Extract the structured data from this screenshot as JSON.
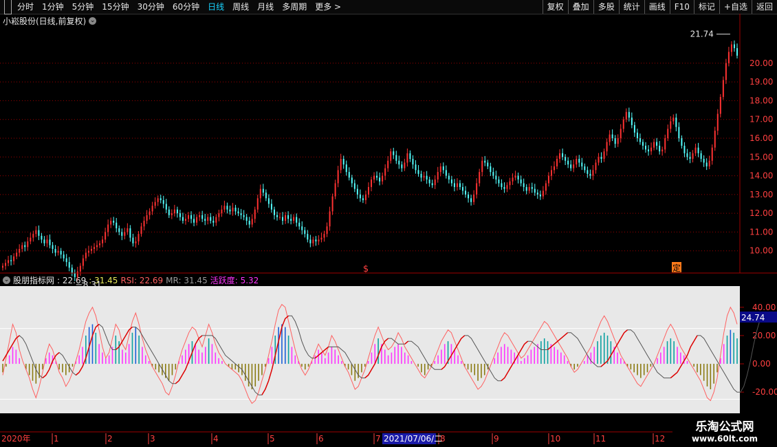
{
  "toolbar": {
    "tabs": [
      "分时",
      "1分钟",
      "5分钟",
      "15分钟",
      "30分钟",
      "60分钟",
      "日线",
      "周线",
      "月线",
      "多周期",
      "更多 >"
    ],
    "active_tab": "日线",
    "right": [
      "复权",
      "叠加",
      "多股",
      "统计",
      "画线",
      "F10",
      "标记",
      "+自选",
      "返回"
    ]
  },
  "price_panel": {
    "title": "小崧股份(日线,前复权)",
    "high_label": "21.74",
    "low_label": "8.31",
    "markers": [
      "$",
      "定"
    ]
  },
  "indicator_panel": {
    "name": "股朋指标网",
    "v1": ": 22.69",
    "v2": ": 31.45",
    "rsi": "RSI: 22.69",
    "mr": "MR: 31.45",
    "huoyue": "活跃度: 5.32",
    "current_value": "24.74"
  },
  "dates": {
    "year": "2020年",
    "months": [
      "1",
      "2",
      "3",
      "4",
      "5",
      "6",
      "7",
      "8",
      "9",
      "10",
      "11",
      "12"
    ],
    "cursor": "2021/07/06/二"
  },
  "colors": {
    "up": "#ff3232",
    "down": "#54ffff",
    "grid": "#a00000",
    "accent": "#19d4ff",
    "rsi": "#ff6060",
    "mr": "#555555",
    "huoyue": "#ff33ff"
  },
  "chart_data": [
    {
      "type": "candlestick",
      "title": "小崧股份(日线,前复权)",
      "ylim": [
        9.0,
        21.9
      ],
      "yticks": [
        10,
        11,
        12,
        13,
        14,
        15,
        16,
        17,
        18,
        19,
        20
      ],
      "ytick_labels": [
        "10.00",
        "11.00",
        "12.00",
        "13.00",
        "14.00",
        "15.00",
        "16.00",
        "17.00",
        "18.00",
        "19.00",
        "20.00"
      ],
      "close": [
        9.2,
        9.35,
        9.5,
        9.45,
        9.7,
        9.9,
        10.1,
        10.3,
        10.2,
        10.5,
        10.7,
        10.9,
        11.1,
        10.8,
        10.6,
        10.4,
        10.6,
        10.3,
        10.1,
        9.9,
        10.0,
        9.8,
        9.6,
        9.4,
        9.1,
        8.8,
        8.6,
        8.9,
        9.2,
        9.6,
        9.9,
        10.0,
        10.1,
        10.2,
        10.3,
        10.4,
        10.6,
        11.0,
        11.4,
        11.6,
        11.5,
        11.2,
        11.0,
        10.8,
        11.0,
        11.2,
        10.7,
        10.4,
        10.5,
        10.9,
        11.3,
        11.6,
        11.9,
        12.1,
        12.4,
        12.6,
        12.8,
        12.7,
        12.5,
        12.2,
        11.9,
        12.0,
        12.2,
        12.0,
        11.8,
        11.6,
        11.7,
        11.9,
        11.7,
        11.5,
        11.8,
        11.9,
        11.7,
        11.6,
        11.8,
        11.6,
        11.5,
        11.8,
        12.0,
        12.2,
        12.4,
        12.2,
        12.1,
        12.3,
        12.1,
        12.0,
        11.9,
        11.8,
        11.6,
        11.4,
        11.7,
        12.2,
        12.8,
        13.3,
        13.1,
        12.8,
        12.5,
        12.2,
        11.9,
        11.8,
        11.8,
        11.6,
        11.9,
        11.7,
        11.6,
        11.8,
        11.5,
        11.3,
        11.1,
        10.9,
        10.6,
        10.4,
        10.6,
        10.5,
        10.6,
        10.7,
        10.9,
        11.3,
        12.1,
        12.9,
        13.6,
        14.3,
        14.9,
        14.6,
        14.2,
        13.9,
        13.6,
        13.3,
        13.0,
        12.8,
        12.7,
        13.0,
        13.4,
        13.8,
        14.0,
        13.9,
        13.7,
        14.0,
        14.4,
        14.8,
        15.3,
        15.1,
        14.8,
        14.6,
        14.4,
        14.7,
        15.2,
        14.9,
        14.6,
        14.3,
        14.1,
        13.9,
        14.0,
        13.8,
        13.6,
        13.5,
        13.8,
        14.2,
        14.5,
        14.3,
        14.0,
        13.8,
        13.6,
        13.4,
        13.6,
        13.4,
        13.2,
        13.0,
        12.8,
        12.6,
        13.0,
        13.6,
        14.2,
        14.8,
        14.7,
        14.5,
        14.2,
        14.0,
        13.8,
        13.6,
        13.4,
        13.3,
        13.5,
        13.7,
        13.9,
        14.0,
        13.8,
        13.6,
        13.4,
        13.2,
        13.4,
        13.3,
        13.1,
        13.0,
        12.9,
        13.2,
        13.6,
        14.0,
        14.3,
        14.5,
        14.9,
        15.2,
        15.0,
        14.8,
        14.6,
        14.4,
        14.6,
        14.9,
        14.7,
        14.5,
        14.3,
        14.1,
        14.0,
        14.3,
        14.7,
        15.0,
        14.9,
        15.3,
        15.8,
        16.2,
        16.0,
        15.7,
        16.0,
        16.5,
        17.0,
        17.4,
        17.1,
        16.7,
        16.3,
        16.0,
        15.8,
        15.6,
        15.4,
        15.3,
        15.5,
        15.8,
        15.6,
        15.3,
        15.4,
        16.0,
        16.5,
        16.9,
        17.1,
        16.6,
        16.0,
        15.6,
        15.2,
        15.0,
        14.9,
        15.2,
        15.5,
        15.2,
        14.9,
        14.7,
        14.5,
        14.8,
        15.5,
        16.4,
        17.3,
        18.2,
        19.1,
        20.0,
        20.6,
        21.0,
        20.8,
        20.4
      ]
    },
    {
      "type": "line",
      "ylim": [
        -35,
        55
      ],
      "yticks": [
        -20,
        0,
        20,
        40
      ],
      "ytick_labels": [
        "-20.00",
        "0.00",
        "20.00",
        "40.00"
      ],
      "series": [
        {
          "name": "RSI",
          "values": [
            -8,
            4,
            16,
            28,
            22,
            10,
            2,
            -4,
            -10,
            -18,
            -24,
            -16,
            -6,
            6,
            14,
            10,
            2,
            -6,
            -10,
            -16,
            -12,
            -6,
            2,
            10,
            20,
            30,
            36,
            40,
            34,
            24,
            12,
            4,
            8,
            18,
            28,
            24,
            14,
            10,
            20,
            30,
            36,
            28,
            18,
            10,
            4,
            -2,
            -6,
            -10,
            -14,
            -20,
            -22,
            -16,
            -8,
            2,
            10,
            16,
            22,
            26,
            24,
            18,
            12,
            20,
            28,
            22,
            14,
            8,
            4,
            0,
            -2,
            -4,
            -6,
            -8,
            -12,
            -18,
            -24,
            -28,
            -26,
            -20,
            -12,
            -4,
            6,
            16,
            28,
            38,
            42,
            40,
            30,
            20,
            10,
            2,
            -4,
            -8,
            -4,
            2,
            8,
            14,
            10,
            6,
            12,
            20,
            16,
            10,
            4,
            -2,
            -6,
            -12,
            -18,
            -16,
            -10,
            -4,
            4,
            12,
            20,
            26,
            20,
            14,
            10,
            12,
            16,
            22,
            18,
            12,
            8,
            4,
            0,
            -4,
            -8,
            -10,
            -6,
            -2,
            4,
            10,
            16,
            20,
            24,
            22,
            16,
            10,
            4,
            -2,
            -6,
            -10,
            -14,
            -18,
            -16,
            -12,
            -6,
            0,
            6,
            12,
            18,
            22,
            20,
            16,
            12,
            8,
            4,
            6,
            10,
            14,
            18,
            22,
            26,
            30,
            28,
            24,
            20,
            16,
            12,
            8,
            4,
            -2,
            -6,
            -4,
            0,
            4,
            8,
            12,
            18,
            24,
            30,
            34,
            30,
            24,
            18,
            12,
            6,
            2,
            -2,
            -6,
            -10,
            -14,
            -16,
            -12,
            -8,
            -4,
            0,
            6,
            12,
            18,
            24,
            28,
            24,
            18,
            12,
            8,
            4,
            0,
            -4,
            -8,
            -12,
            -18,
            -24,
            -26,
            -20,
            -10,
            6,
            22,
            34,
            40,
            36,
            28
          ]
        },
        {
          "name": "MR",
          "values": [
            2,
            6,
            10,
            14,
            18,
            20,
            18,
            14,
            8,
            2,
            -4,
            -8,
            -10,
            -8,
            -4,
            2,
            6,
            8,
            6,
            2,
            -2,
            -6,
            -8,
            -6,
            -2,
            4,
            12,
            20,
            26,
            28,
            26,
            20,
            14,
            10,
            10,
            12,
            16,
            20,
            24,
            26,
            26,
            24,
            20,
            16,
            12,
            8,
            4,
            0,
            -4,
            -8,
            -12,
            -14,
            -14,
            -12,
            -8,
            -4,
            2,
            8,
            14,
            18,
            20,
            20,
            20,
            20,
            18,
            14,
            10,
            6,
            4,
            2,
            0,
            -2,
            -4,
            -8,
            -12,
            -16,
            -20,
            -22,
            -22,
            -18,
            -12,
            -4,
            6,
            16,
            26,
            32,
            34,
            34,
            30,
            24,
            16,
            10,
            6,
            4,
            4,
            6,
            8,
            10,
            12,
            12,
            12,
            12,
            10,
            8,
            4,
            0,
            -4,
            -8,
            -10,
            -10,
            -8,
            -4,
            0,
            6,
            12,
            16,
            18,
            18,
            16,
            14,
            14,
            14,
            16,
            16,
            14,
            12,
            8,
            4,
            0,
            -2,
            -4,
            -4,
            -4,
            -2,
            2,
            6,
            10,
            14,
            18,
            20,
            20,
            18,
            14,
            10,
            6,
            2,
            -2,
            -6,
            -10,
            -12,
            -12,
            -10,
            -6,
            -2,
            2,
            6,
            10,
            14,
            16,
            16,
            14,
            12,
            10,
            10,
            10,
            12,
            14,
            16,
            18,
            20,
            22,
            22,
            20,
            18,
            14,
            10,
            6,
            2,
            0,
            -2,
            -2,
            0,
            2,
            6,
            10,
            14,
            18,
            22,
            24,
            24,
            22,
            18,
            14,
            10,
            6,
            2,
            -2,
            -6,
            -8,
            -10,
            -10,
            -10,
            -8,
            -6,
            -2,
            2,
            6,
            12,
            16,
            20,
            20,
            18,
            14,
            10,
            6,
            2,
            -2,
            -6,
            -10,
            -14,
            -18,
            -20,
            -20,
            -16,
            -8,
            2,
            14,
            24,
            32,
            36,
            36
          ]
        },
        {
          "name": "活跃度",
          "values": [
            -6,
            -2,
            6,
            12,
            10,
            4,
            0,
            -4,
            -8,
            -12,
            -14,
            -10,
            -4,
            4,
            8,
            6,
            2,
            -4,
            -6,
            -8,
            -6,
            -2,
            2,
            6,
            12,
            20,
            26,
            28,
            22,
            14,
            8,
            4,
            6,
            12,
            20,
            16,
            10,
            8,
            14,
            22,
            26,
            20,
            12,
            6,
            2,
            -2,
            -4,
            -6,
            -8,
            -10,
            -12,
            -8,
            -4,
            2,
            6,
            10,
            14,
            16,
            14,
            10,
            8,
            12,
            18,
            14,
            8,
            4,
            2,
            0,
            -2,
            -4,
            -4,
            -6,
            -8,
            -12,
            -16,
            -18,
            -16,
            -12,
            -8,
            -2,
            4,
            12,
            20,
            26,
            28,
            26,
            20,
            12,
            6,
            2,
            -2,
            -4,
            -2,
            2,
            6,
            10,
            8,
            4,
            8,
            12,
            10,
            6,
            2,
            -2,
            -4,
            -8,
            -12,
            -10,
            -6,
            -2,
            2,
            8,
            14,
            18,
            14,
            10,
            6,
            8,
            12,
            14,
            12,
            8,
            6,
            2,
            0,
            -2,
            -6,
            -8,
            -4,
            -2,
            2,
            6,
            10,
            14,
            16,
            14,
            10,
            6,
            2,
            -2,
            -4,
            -6,
            -8,
            -12,
            -10,
            -8,
            -4,
            0,
            4,
            8,
            12,
            14,
            12,
            10,
            8,
            6,
            2,
            4,
            6,
            10,
            12,
            14,
            16,
            18,
            16,
            14,
            12,
            10,
            8,
            6,
            2,
            -2,
            -4,
            -2,
            0,
            2,
            6,
            8,
            12,
            16,
            20,
            22,
            20,
            16,
            12,
            8,
            4,
            2,
            -2,
            -4,
            -6,
            -8,
            -10,
            -8,
            -6,
            -2,
            0,
            4,
            8,
            12,
            16,
            18,
            16,
            12,
            8,
            6,
            2,
            0,
            -2,
            -6,
            -8,
            -12,
            -16,
            -18,
            -14,
            -6,
            4,
            14,
            20,
            24,
            22,
            18
          ]
        }
      ]
    }
  ]
}
